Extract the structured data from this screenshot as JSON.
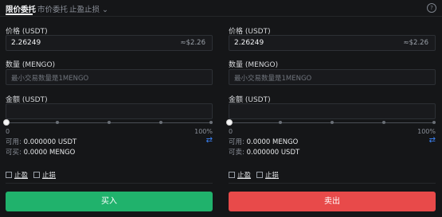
{
  "tabs": {
    "limit": "限价委托",
    "market": "市价委托",
    "stop": "止盈止损"
  },
  "help_icon": "question-circle-icon",
  "left": {
    "price_label": "价格 (USDT)",
    "price_value": "2.26249",
    "price_hint": "≈$2.26",
    "qty_label": "数量 (MENGO)",
    "qty_placeholder": "最小交易数量是1MENGO",
    "amount_label": "金额 (USDT)",
    "slider_min": "0",
    "slider_max": "100%",
    "slider_percent": 0,
    "available_label": "可用: ",
    "available_value": "0.000000 USDT",
    "buyable_label": "可买: ",
    "buyable_value": "0.0000 MENGO",
    "take_profit": "止盈",
    "stop_loss": "止损",
    "button": "买入"
  },
  "right": {
    "price_label": "价格 (USDT)",
    "price_value": "2.26249",
    "price_hint": "≈$2.26",
    "qty_label": "数量 (MENGO)",
    "qty_placeholder": "最小交易数量是1MENGO",
    "amount_label": "金额 (USDT)",
    "slider_min": "0",
    "slider_max": "100%",
    "slider_percent": 0,
    "available_label": "可用: ",
    "available_value": "0.0000 MENGO",
    "sellable_label": "可卖: ",
    "sellable_value": "0.000000 USDT",
    "take_profit": "止盈",
    "stop_loss": "止损",
    "button": "卖出"
  },
  "colors": {
    "buy": "#20b26c",
    "sell": "#e84a4a",
    "accent_blue": "#3b82f6"
  }
}
